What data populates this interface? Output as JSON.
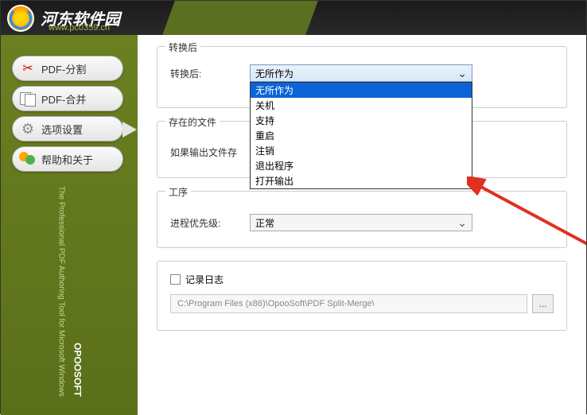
{
  "header": {
    "title": "河东软件园",
    "subtitle": "www.pc0359.cn"
  },
  "sidebar": {
    "items": [
      {
        "label": "PDF-分割",
        "icon": "scissors"
      },
      {
        "label": "PDF-合并",
        "icon": "merge"
      },
      {
        "label": "选项设置",
        "icon": "gear"
      },
      {
        "label": "帮助和关于",
        "icon": "help"
      }
    ],
    "tagline": "The Professional PDF Authoring Tool for Microsoft Windows",
    "brand": "OPOOSOFT"
  },
  "sections": {
    "after_convert": {
      "legend": "转换后",
      "label": "转换后:",
      "selected": "无所作为",
      "options": [
        "无所作为",
        "关机",
        "支持",
        "重启",
        "注销",
        "退出程序",
        "打开输出"
      ]
    },
    "existing_file": {
      "legend": "存在的文件",
      "label": "如果输出文件存"
    },
    "process": {
      "legend": "工序",
      "label": "进程优先级:",
      "value": "正常"
    },
    "log": {
      "checkbox_label": "记录日志",
      "path": "C:\\Program Files (x86)\\OpooSoft\\PDF Split-Merge\\",
      "browse": "..."
    }
  }
}
